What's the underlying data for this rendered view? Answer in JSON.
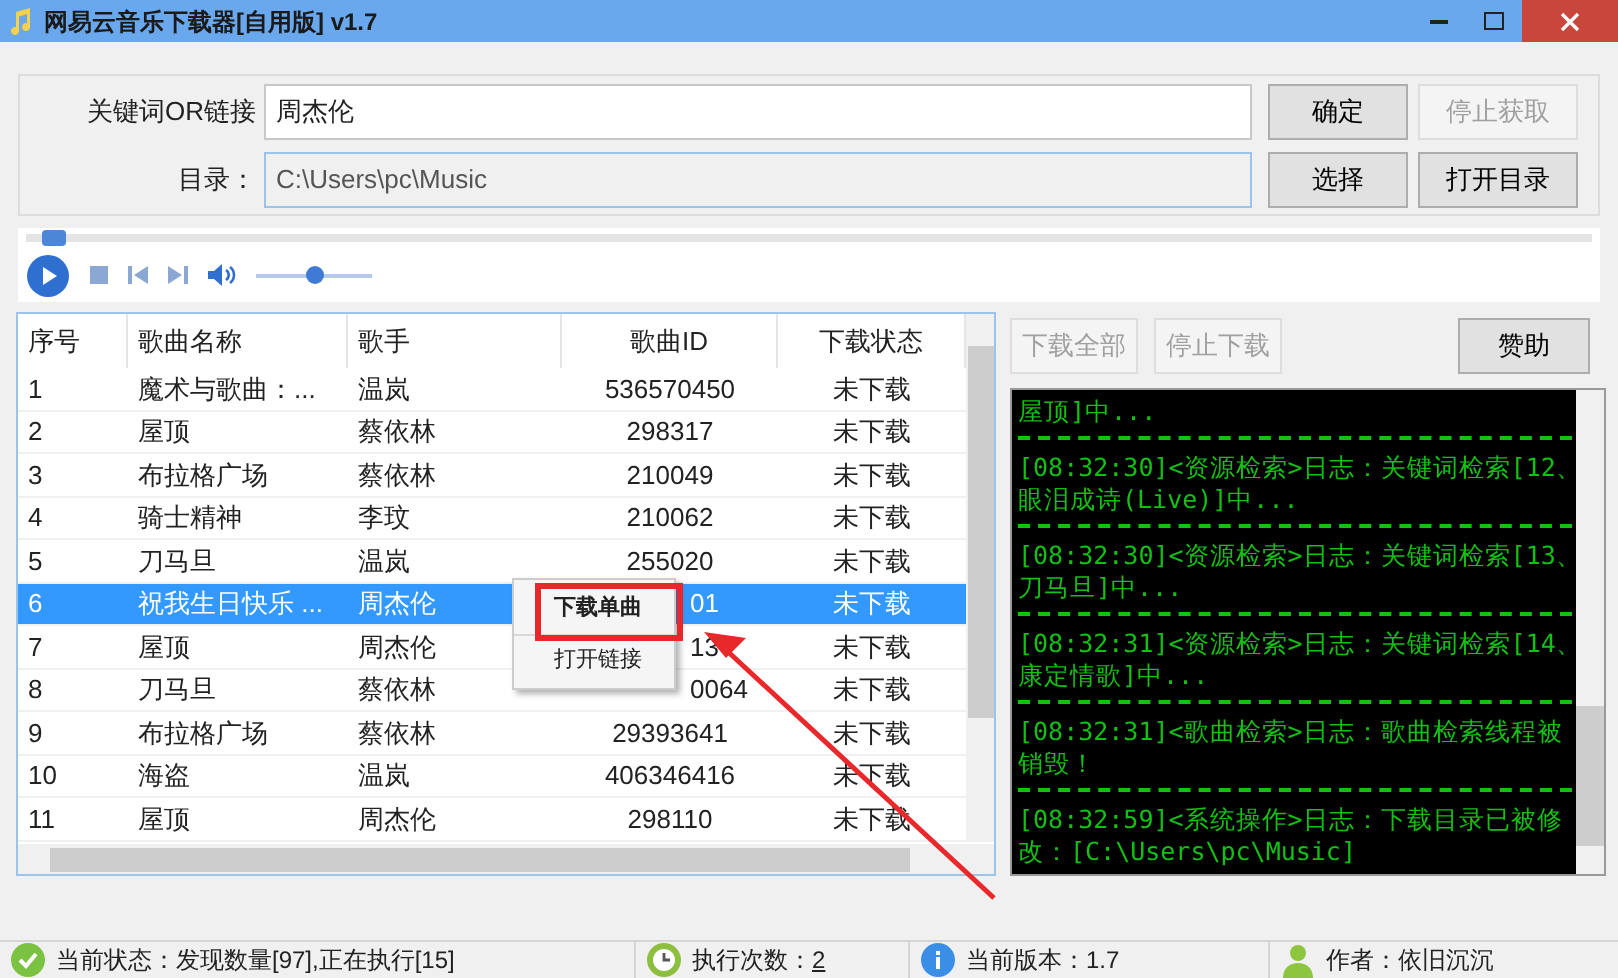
{
  "window": {
    "title": "网易云音乐下载器[自用版] v1.7"
  },
  "search": {
    "label": "关键词OR链接",
    "value": "周杰伦",
    "confirm": "确定",
    "stop": {
      "label": "停止获取",
      "disabled": true
    }
  },
  "directory": {
    "label": "目录：",
    "value": "C:\\Users\\pc\\Music",
    "choose": "选择",
    "open": "打开目录"
  },
  "player": {
    "seek": {
      "level": 0.01
    },
    "volume": {
      "level": 0.5
    }
  },
  "table": {
    "columns": [
      "序号",
      "歌曲名称",
      "歌手",
      "歌曲ID",
      "下载状态"
    ],
    "rows": [
      {
        "no": "1",
        "name": "魔术与歌曲：...",
        "singer": "温岚",
        "id": "536570450",
        "status": "未下载",
        "selected": false
      },
      {
        "no": "2",
        "name": "屋顶",
        "singer": "蔡依林",
        "id": "298317",
        "status": "未下载",
        "selected": false
      },
      {
        "no": "3",
        "name": "布拉格广场",
        "singer": "蔡依林",
        "id": "210049",
        "status": "未下载",
        "selected": false
      },
      {
        "no": "4",
        "name": "骑士精神",
        "singer": "李玟",
        "id": "210062",
        "status": "未下载",
        "selected": false
      },
      {
        "no": "5",
        "name": "刀马旦",
        "singer": "温岚",
        "id": "255020",
        "status": "未下载",
        "selected": false
      },
      {
        "no": "6",
        "name": "祝我生日快乐 ...",
        "singer": "周杰伦",
        "id": "01",
        "id_cut": true,
        "status": "未下载",
        "selected": true
      },
      {
        "no": "7",
        "name": "屋顶",
        "singer": "周杰伦",
        "id": "13",
        "id_cut": true,
        "status": "未下载",
        "selected": false
      },
      {
        "no": "8",
        "name": "刀马旦",
        "singer": "蔡依林",
        "id": "0064",
        "id_cut": true,
        "status": "未下载",
        "selected": false
      },
      {
        "no": "9",
        "name": "布拉格广场",
        "singer": "蔡依林",
        "id": "29393641",
        "status": "未下载",
        "selected": false
      },
      {
        "no": "10",
        "name": "海盗",
        "singer": "温岚",
        "id": "406346416",
        "status": "未下载",
        "selected": false
      },
      {
        "no": "11",
        "name": "屋顶",
        "singer": "周杰伦",
        "id": "298110",
        "status": "未下载",
        "selected": false
      }
    ]
  },
  "context_menu": {
    "items": [
      {
        "label": "下载单曲",
        "highlighted": true
      },
      {
        "label": "打开链接",
        "highlighted": false
      }
    ]
  },
  "actions": [
    {
      "label": "下载全部",
      "disabled": true
    },
    {
      "label": "停止下载",
      "disabled": true
    },
    {
      "label": "赞助",
      "disabled": false
    }
  ],
  "log": [
    {
      "lines": [
        "屋顶]中..."
      ]
    },
    {
      "lines": [
        "[08:32:30]<资源检索>日志：关键词检索[12、",
        "眼泪成诗(Live)]中..."
      ]
    },
    {
      "lines": [
        "[08:32:30]<资源检索>日志：关键词检索[13、",
        "刀马旦]中..."
      ]
    },
    {
      "lines": [
        "[08:32:31]<资源检索>日志：关键词检索[14、",
        "康定情歌]中..."
      ]
    },
    {
      "lines": [
        "[08:32:31]<歌曲检索>日志：歌曲检索线程被",
        "销毁！"
      ]
    },
    {
      "lines": [
        "[08:32:59]<系统操作>日志：下载目录已被修",
        "改：[C:\\Users\\pc\\Music]"
      ]
    }
  ],
  "status_bar": [
    {
      "kind": "check",
      "label": "当前状态：发现数量[97],正在执行[15]"
    },
    {
      "kind": "clock",
      "label": "执行次数：",
      "value": "2"
    },
    {
      "kind": "info",
      "label": "当前版本：1.7"
    },
    {
      "kind": "person",
      "label": "作者：依旧沉沉"
    }
  ]
}
